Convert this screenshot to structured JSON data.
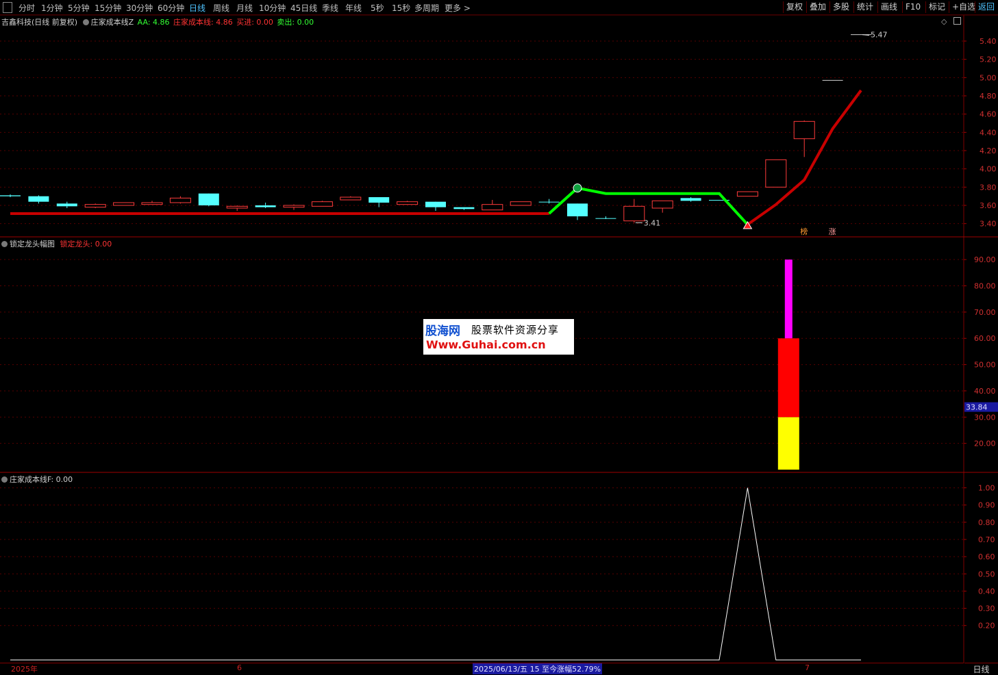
{
  "toolbar": {
    "left": [
      "分时",
      "1分钟",
      "5分钟",
      "15分钟",
      "30分钟",
      "60分钟",
      "日线",
      "周线",
      "月线",
      "10分钟",
      "45日线",
      "季线",
      "年线",
      "5秒",
      "15秒",
      "多周期",
      "更多 >"
    ],
    "active_index": 6,
    "right": [
      "复权",
      "叠加",
      "多股",
      "统计",
      "画线",
      "F10",
      "标记",
      "+自选",
      "返回"
    ],
    "right_active_index": 8
  },
  "pane1": {
    "stock_title": "吉鑫科技(日线 前复权)",
    "indicator_name": "庄家成本线Z",
    "aa_label": "AA: 4.86",
    "cost_label": "庄家成本线: 4.86",
    "buy_label": "买进: 0.00",
    "sell_label": "卖出: 0.00",
    "high_marker": "5.47",
    "low_marker": "3.41",
    "badges": [
      "榜",
      "涨"
    ],
    "yaxis": [
      "5.40",
      "5.20",
      "5.00",
      "4.80",
      "4.60",
      "4.40",
      "4.20",
      "4.00",
      "3.80",
      "3.60",
      "3.40"
    ],
    "colors": {
      "up": "#ff3b3b",
      "down": "#54ffff",
      "cost_red": "#c80000",
      "cost_green": "#00ff00"
    }
  },
  "pane2": {
    "indicator_name": "锁定龙头幅图",
    "value_label": "锁定龙头: 0.00",
    "yaxis": [
      "90.00",
      "80.00",
      "70.00",
      "60.00",
      "50.00",
      "40.00",
      "30.00",
      "20.00"
    ],
    "current_value": "33.84",
    "bar_segments": [
      {
        "from": 10,
        "to": 30,
        "color": "#ffff00"
      },
      {
        "from": 30,
        "to": 60,
        "color": "#ff0000"
      },
      {
        "from": 60,
        "to": 90,
        "color": "#ff00ff"
      }
    ]
  },
  "pane3": {
    "indicator_name": "庄家成本线F",
    "value_label": ": 0.00",
    "yaxis": [
      "1.00",
      "0.90",
      "0.80",
      "0.70",
      "0.60",
      "0.50",
      "0.40",
      "0.30",
      "0.20"
    ]
  },
  "datebar": {
    "year": "2025年",
    "month6": "6",
    "selected_info": "2025/06/13/五 15 至今涨幅52.79%",
    "month7": "7",
    "period": "日线"
  },
  "watermark": {
    "logo": "股海网",
    "slogan": "股票软件资源分享",
    "url": "Www.Guhai.com.cn"
  },
  "chart_data": {
    "type": "candlestick",
    "dates_note": "",
    "candles": [
      {
        "o": 3.7,
        "h": 3.72,
        "l": 3.69,
        "c": 3.71,
        "dir": "down"
      },
      {
        "o": 3.7,
        "h": 3.71,
        "l": 3.62,
        "c": 3.64,
        "dir": "down"
      },
      {
        "o": 3.62,
        "h": 3.64,
        "l": 3.57,
        "c": 3.59,
        "dir": "down"
      },
      {
        "o": 3.58,
        "h": 3.62,
        "l": 3.57,
        "c": 3.61,
        "dir": "up"
      },
      {
        "o": 3.6,
        "h": 3.63,
        "l": 3.6,
        "c": 3.63,
        "dir": "up"
      },
      {
        "o": 3.61,
        "h": 3.65,
        "l": 3.61,
        "c": 3.63,
        "dir": "up"
      },
      {
        "o": 3.63,
        "h": 3.7,
        "l": 3.62,
        "c": 3.68,
        "dir": "up"
      },
      {
        "o": 3.73,
        "h": 3.73,
        "l": 3.59,
        "c": 3.6,
        "dir": "down"
      },
      {
        "o": 3.57,
        "h": 3.6,
        "l": 3.54,
        "c": 3.59,
        "dir": "up"
      },
      {
        "o": 3.6,
        "h": 3.63,
        "l": 3.57,
        "c": 3.58,
        "dir": "down"
      },
      {
        "o": 3.58,
        "h": 3.61,
        "l": 3.55,
        "c": 3.6,
        "dir": "up"
      },
      {
        "o": 3.59,
        "h": 3.65,
        "l": 3.59,
        "c": 3.64,
        "dir": "up"
      },
      {
        "o": 3.66,
        "h": 3.7,
        "l": 3.66,
        "c": 3.69,
        "dir": "up"
      },
      {
        "o": 3.69,
        "h": 3.69,
        "l": 3.58,
        "c": 3.63,
        "dir": "down"
      },
      {
        "o": 3.61,
        "h": 3.65,
        "l": 3.61,
        "c": 3.64,
        "dir": "up"
      },
      {
        "o": 3.64,
        "h": 3.64,
        "l": 3.54,
        "c": 3.58,
        "dir": "down"
      },
      {
        "o": 3.58,
        "h": 3.58,
        "l": 3.55,
        "c": 3.56,
        "dir": "down"
      },
      {
        "o": 3.55,
        "h": 3.66,
        "l": 3.55,
        "c": 3.61,
        "dir": "up"
      },
      {
        "o": 3.6,
        "h": 3.64,
        "l": 3.6,
        "c": 3.64,
        "dir": "up"
      },
      {
        "o": 3.64,
        "h": 3.67,
        "l": 3.62,
        "c": 3.64,
        "dir": "down"
      },
      {
        "o": 3.62,
        "h": 3.62,
        "l": 3.44,
        "c": 3.48,
        "dir": "down"
      },
      {
        "o": 3.46,
        "h": 3.48,
        "l": 3.45,
        "c": 3.46,
        "dir": "down"
      },
      {
        "o": 3.43,
        "h": 3.67,
        "l": 3.41,
        "c": 3.59,
        "dir": "up"
      },
      {
        "o": 3.57,
        "h": 3.65,
        "l": 3.52,
        "c": 3.65,
        "dir": "up"
      },
      {
        "o": 3.68,
        "h": 3.69,
        "l": 3.64,
        "c": 3.65,
        "dir": "down"
      },
      {
        "o": 3.66,
        "h": 3.66,
        "l": 3.66,
        "c": 3.66,
        "dir": "down"
      },
      {
        "o": 3.7,
        "h": 3.75,
        "l": 3.7,
        "c": 3.75,
        "dir": "up"
      },
      {
        "o": 3.8,
        "h": 4.1,
        "l": 3.8,
        "c": 4.1,
        "dir": "up"
      },
      {
        "o": 4.33,
        "h": 4.53,
        "l": 4.13,
        "c": 4.52,
        "dir": "up"
      },
      {
        "o": 4.97,
        "h": 4.97,
        "l": 4.97,
        "c": 4.97,
        "dir": "flat"
      },
      {
        "o": 5.47,
        "h": 5.47,
        "l": 5.47,
        "c": 5.47,
        "dir": "flat"
      }
    ],
    "cost_line": [
      3.51,
      3.51,
      3.51,
      3.51,
      3.51,
      3.51,
      3.51,
      3.51,
      3.51,
      3.51,
      3.51,
      3.51,
      3.51,
      3.51,
      3.51,
      3.51,
      3.51,
      3.51,
      3.51,
      3.51,
      3.79,
      3.73,
      3.73,
      3.73,
      3.73,
      3.73,
      3.39,
      3.61,
      3.88,
      4.44,
      4.86
    ],
    "cost_green_from": 19,
    "cost_green_to": 26,
    "f_series": [
      0,
      0,
      0,
      0,
      0,
      0,
      0,
      0,
      0,
      0,
      0,
      0,
      0,
      0,
      0,
      0,
      0,
      0,
      0,
      0,
      0,
      0,
      0,
      0,
      0,
      0,
      1,
      0,
      0,
      0,
      0
    ],
    "ylim_price": [
      3.3,
      5.55
    ],
    "ylim_bar": [
      10,
      95
    ],
    "ylim_f": [
      0,
      1.05
    ]
  }
}
